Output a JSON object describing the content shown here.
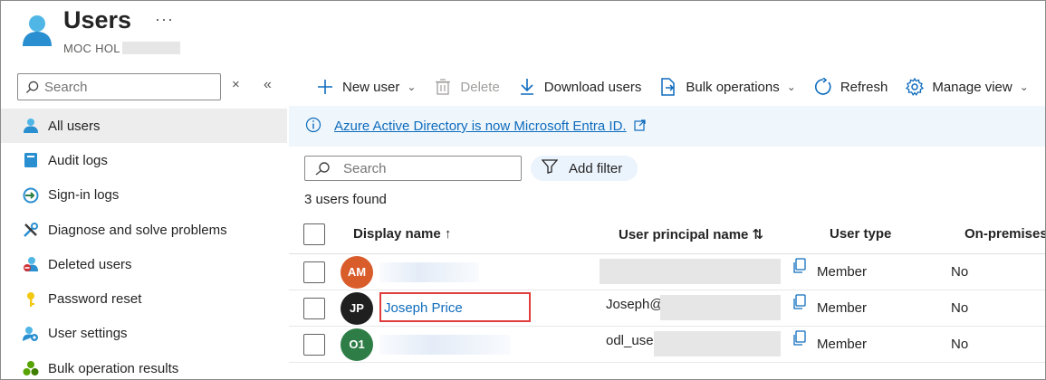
{
  "header": {
    "title": "Users",
    "more": "···",
    "subtitle": "MOC HOL"
  },
  "sidebar": {
    "search_placeholder": "Search",
    "clear": "×",
    "collapse": "«",
    "items": [
      {
        "label": "All users",
        "icon": "user-icon"
      },
      {
        "label": "Audit logs",
        "icon": "log-icon"
      },
      {
        "label": "Sign-in logs",
        "icon": "signin-icon"
      },
      {
        "label": "Diagnose and solve problems",
        "icon": "wrench-icon"
      },
      {
        "label": "Deleted users",
        "icon": "deleted-user-icon"
      },
      {
        "label": "Password reset",
        "icon": "key-icon"
      },
      {
        "label": "User settings",
        "icon": "user-settings-icon"
      },
      {
        "label": "Bulk operation results",
        "icon": "bulk-results-icon"
      }
    ]
  },
  "toolbar": {
    "new_user": "New user",
    "delete": "Delete",
    "download_users": "Download users",
    "bulk_operations": "Bulk operations",
    "refresh": "Refresh",
    "manage_view": "Manage view"
  },
  "banner": {
    "text": "Azure Active Directory is now Microsoft Entra ID."
  },
  "filters": {
    "search_placeholder": "Search",
    "add_filter": "Add filter",
    "count_text": "3 users found"
  },
  "table": {
    "headers": {
      "display_name": "Display name ↑",
      "upn": "User principal name ⇅",
      "user_type": "User type",
      "on_premises": "On-premises"
    },
    "rows": [
      {
        "initials": "AM",
        "avatar_color": "#d95c2b",
        "display_name": "",
        "upn": "",
        "user_type": "Member",
        "on_premises": "No"
      },
      {
        "initials": "JP",
        "avatar_color": "#1f1f1f",
        "display_name": "Joseph Price",
        "upn": "Joseph@",
        "user_type": "Member",
        "on_premises": "No"
      },
      {
        "initials": "O1",
        "avatar_color": "#2e7d46",
        "display_name": "",
        "upn": "odl_user",
        "user_type": "Member",
        "on_premises": "No"
      }
    ]
  },
  "colors": {
    "accent": "#0f6cbd",
    "banner_bg": "#eff6fc",
    "highlight_box": "#e03c3c"
  }
}
